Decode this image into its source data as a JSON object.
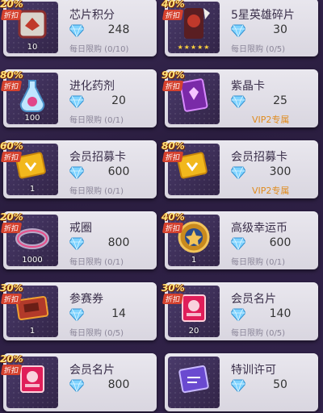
{
  "shop": {
    "items": [
      {
        "discount": "20%",
        "discount_label": "折扣",
        "name": "芯片积分",
        "price": "248",
        "limit": "每日限购 (0/10)",
        "qty": "10",
        "art": "chip-points-icon"
      },
      {
        "discount": "40%",
        "discount_label": "折扣",
        "name": "5星英雄碎片",
        "price": "30",
        "limit": "每日限购 (0/5)",
        "qty": "",
        "art": "hero-shard-icon",
        "stars": "★★★★★"
      },
      {
        "discount": "80%",
        "discount_label": "折扣",
        "name": "进化药剂",
        "price": "20",
        "limit": "每日限购 (0/1)",
        "qty": "100",
        "art": "evolution-potion-icon"
      },
      {
        "discount": "90%",
        "discount_label": "折扣",
        "name": "紫晶卡",
        "price": "25",
        "limit": "VIP2专属",
        "qty": "",
        "art": "amethyst-card-icon",
        "vip": true
      },
      {
        "discount": "60%",
        "discount_label": "折扣",
        "name": "会员招募卡",
        "price": "600",
        "limit": "每日限购 (0/1)",
        "qty": "1",
        "art": "recruit-card-icon"
      },
      {
        "discount": "80%",
        "discount_label": "折扣",
        "name": "会员招募卡",
        "price": "300",
        "limit": "VIP2专属",
        "qty": "",
        "art": "recruit-card-icon",
        "vip": true
      },
      {
        "discount": "20%",
        "discount_label": "折扣",
        "name": "戒圈",
        "price": "800",
        "limit": "每日限购 (0/1)",
        "qty": "1000",
        "art": "ring-icon"
      },
      {
        "discount": "40%",
        "discount_label": "折扣",
        "name": "高级幸运币",
        "price": "600",
        "limit": "每日限购 (0/1)",
        "qty": "1",
        "art": "lucky-coin-icon"
      },
      {
        "discount": "30%",
        "discount_label": "折扣",
        "name": "参赛券",
        "price": "14",
        "limit": "每日限购 (0/5)",
        "qty": "1",
        "art": "entry-ticket-icon"
      },
      {
        "discount": "30%",
        "discount_label": "折扣",
        "name": "会员名片",
        "price": "140",
        "limit": "每日限购 (0/5)",
        "qty": "20",
        "art": "member-card-icon"
      },
      {
        "discount": "20%",
        "discount_label": "折扣",
        "name": "会员名片",
        "price": "800",
        "limit": "",
        "qty": "",
        "art": "member-card-icon"
      },
      {
        "discount": "",
        "discount_label": "",
        "name": "特训许可",
        "price": "50",
        "limit": "",
        "qty": "",
        "art": "training-permit-icon"
      }
    ]
  },
  "colors": {
    "accent": "#e08b1e",
    "card_bg": "#e4e1ea",
    "badge": "#d4412e",
    "diamond": "#7fd3ff"
  }
}
